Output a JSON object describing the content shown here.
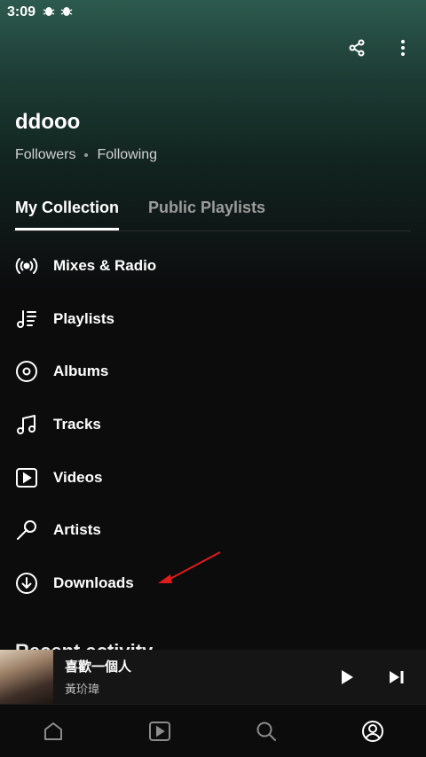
{
  "status_bar": {
    "time": "3:09",
    "icons": [
      "bug-icon",
      "bug-icon"
    ]
  },
  "header": {
    "actions": [
      "share-icon",
      "more-vertical-icon"
    ]
  },
  "profile": {
    "name": "ddooo",
    "followers_label": "Followers",
    "following_label": "Following"
  },
  "tabs": [
    {
      "label": "My Collection",
      "active": true
    },
    {
      "label": "Public Playlists",
      "active": false
    }
  ],
  "collection": {
    "items": [
      {
        "label": "Mixes & Radio",
        "icon": "radio-icon"
      },
      {
        "label": "Playlists",
        "icon": "playlist-icon"
      },
      {
        "label": "Albums",
        "icon": "album-icon"
      },
      {
        "label": "Tracks",
        "icon": "music-note-icon"
      },
      {
        "label": "Videos",
        "icon": "video-icon"
      },
      {
        "label": "Artists",
        "icon": "microphone-icon"
      },
      {
        "label": "Downloads",
        "icon": "download-icon"
      }
    ]
  },
  "recent": {
    "title": "Recent activity"
  },
  "now_playing": {
    "title": "喜歡一個人",
    "artist": "黃玠瑋"
  },
  "bottom_nav": [
    {
      "name": "home",
      "icon": "home-icon"
    },
    {
      "name": "videos",
      "icon": "video-icon"
    },
    {
      "name": "search",
      "icon": "search-icon"
    },
    {
      "name": "profile",
      "icon": "profile-icon",
      "active": true
    }
  ],
  "colors": {
    "background": "#0c0c0d",
    "hero_top": "#2d5a4e",
    "annotation_arrow": "#e01b1b"
  }
}
